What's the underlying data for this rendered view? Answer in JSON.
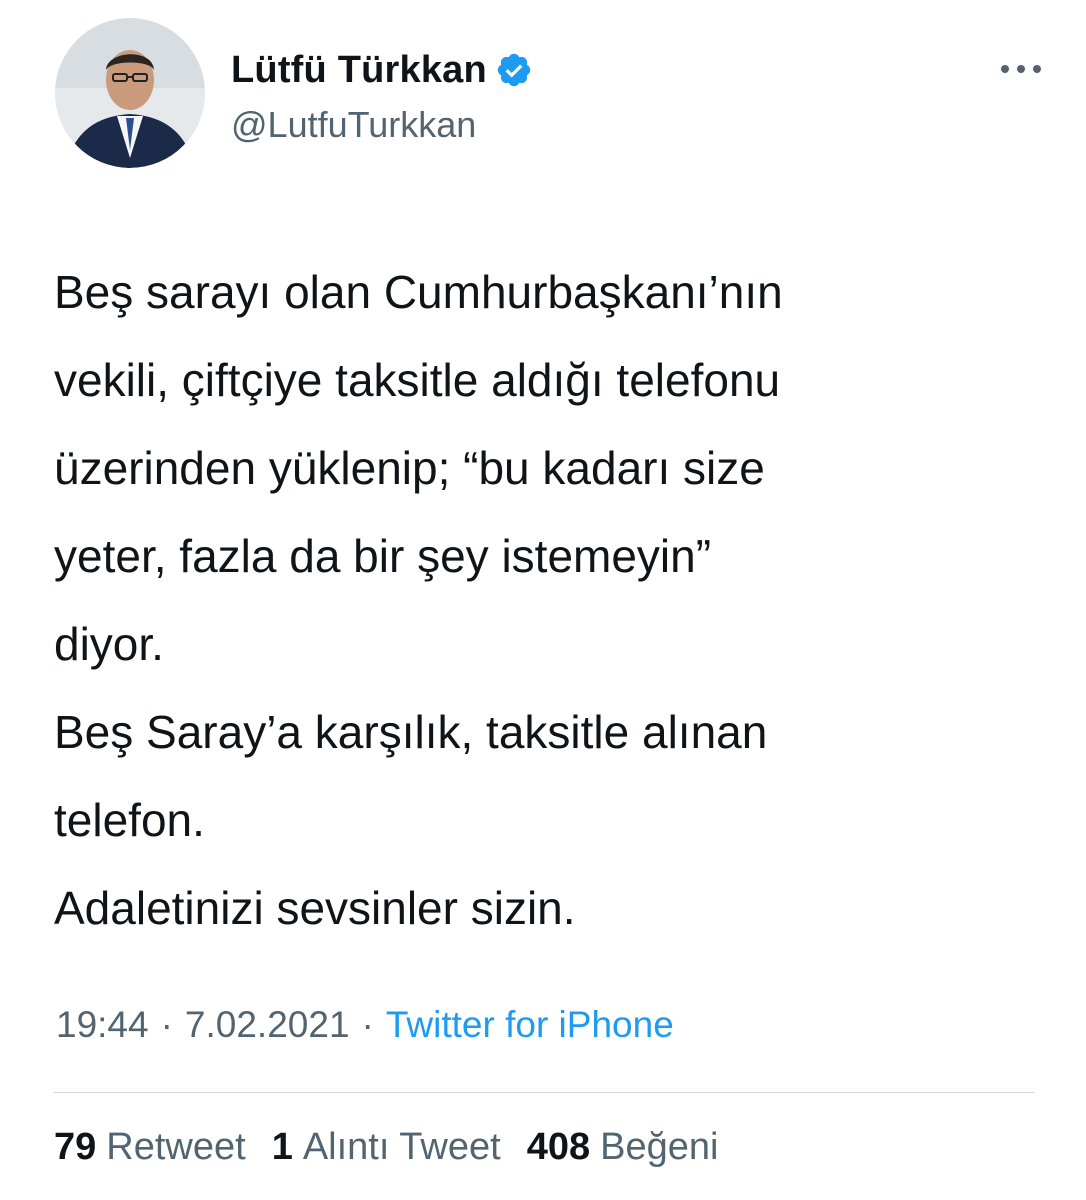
{
  "author": {
    "display_name": "Lütfü Türkkan",
    "handle": "@LutfuTurkkan",
    "verified": true,
    "avatar_icon": "profile-photo"
  },
  "tweet": {
    "text": "Beş sarayı olan Cumhurbaşkanı’nın\nvekili, çiftçiye taksitle aldığı telefonu\nüzerinden yüklenip; “bu kadarı size\nyeter, fazla da bir şey istemeyin”\ndiyor.\nBeş Saray’a karşılık, taksitle alınan\ntelefon.\nAdaletinizi sevsinler sizin.",
    "time": "19:44",
    "date": "7.02.2021",
    "separator": "·",
    "source": "Twitter for iPhone"
  },
  "stats": [
    {
      "count": "79",
      "label": "Retweet"
    },
    {
      "count": "1",
      "label": "Alıntı Tweet"
    },
    {
      "count": "408",
      "label": "Beğeni"
    }
  ],
  "icons": {
    "verified": "verified-badge-icon",
    "more": "more-options-icon"
  },
  "colors": {
    "link": "#1d9bf0",
    "secondary_text": "#536471",
    "primary_text": "#0f1419",
    "verified_badge": "#1d9bf0"
  }
}
